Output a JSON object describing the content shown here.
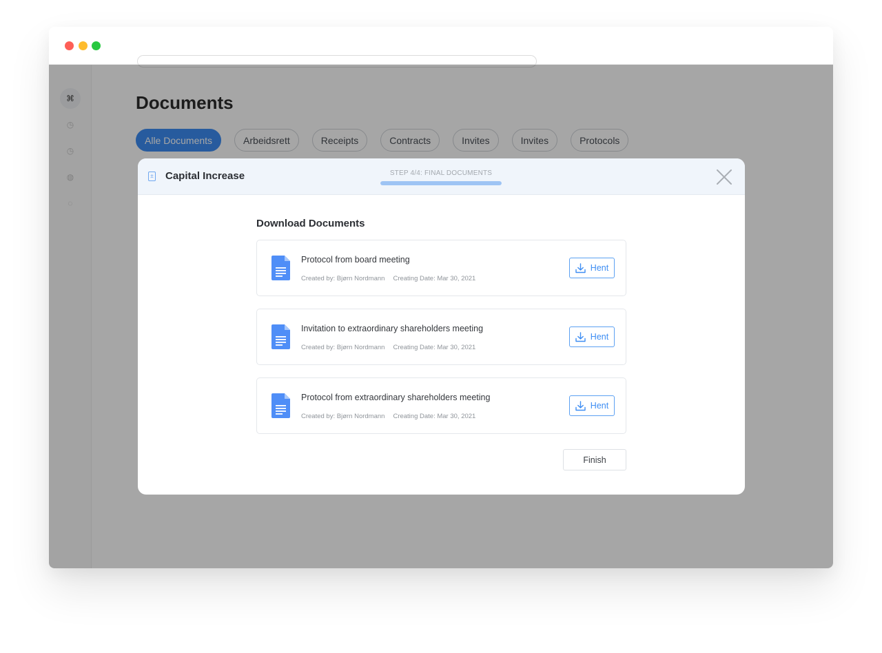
{
  "window": {
    "title_dots": [
      "red",
      "yellow",
      "green"
    ]
  },
  "sidebar": {
    "items": [
      {
        "icon": "command-icon",
        "glyph": "⌘"
      },
      {
        "icon": "chart-icon",
        "glyph": "◷"
      },
      {
        "icon": "clock-icon",
        "glyph": "◷"
      },
      {
        "icon": "globe-icon",
        "glyph": "◍"
      },
      {
        "icon": "circle-icon",
        "glyph": "◌"
      }
    ]
  },
  "page": {
    "title": "Documents",
    "chips": [
      "Alle Documents",
      "Arbeidsrett",
      "Receipts",
      "Contracts",
      "Invites",
      "Invites",
      "Protocols"
    ],
    "active_chip": "Alle Documents"
  },
  "modal": {
    "title": "Capital Increase",
    "step_label": "STEP 4/4: FINAL DOCUMENTS",
    "step_progress": 1.0,
    "section_title": "Download Documents",
    "documents": [
      {
        "name": "Protocol from board meeting",
        "created_by": "Created by: Bjørn Nordmann",
        "creating_date": "Creating Date: Mar 30, 2021",
        "button_label": "Hent"
      },
      {
        "name": "Invitation to extraordinary shareholders meeting",
        "created_by": "Created by: Bjørn Nordmann",
        "creating_date": "Creating Date: Mar 30, 2021",
        "button_label": "Hent"
      },
      {
        "name": "Protocol from extraordinary shareholders meeting",
        "created_by": "Created by: Bjørn Nordmann",
        "creating_date": "Creating Date: Mar 30, 2021",
        "button_label": "Hent"
      }
    ],
    "finish_label": "Finish"
  },
  "colors": {
    "accent": "#3d8df3",
    "doc_icon": "#4f8ef7",
    "overlay": "rgba(0,0,0,0.35)"
  }
}
